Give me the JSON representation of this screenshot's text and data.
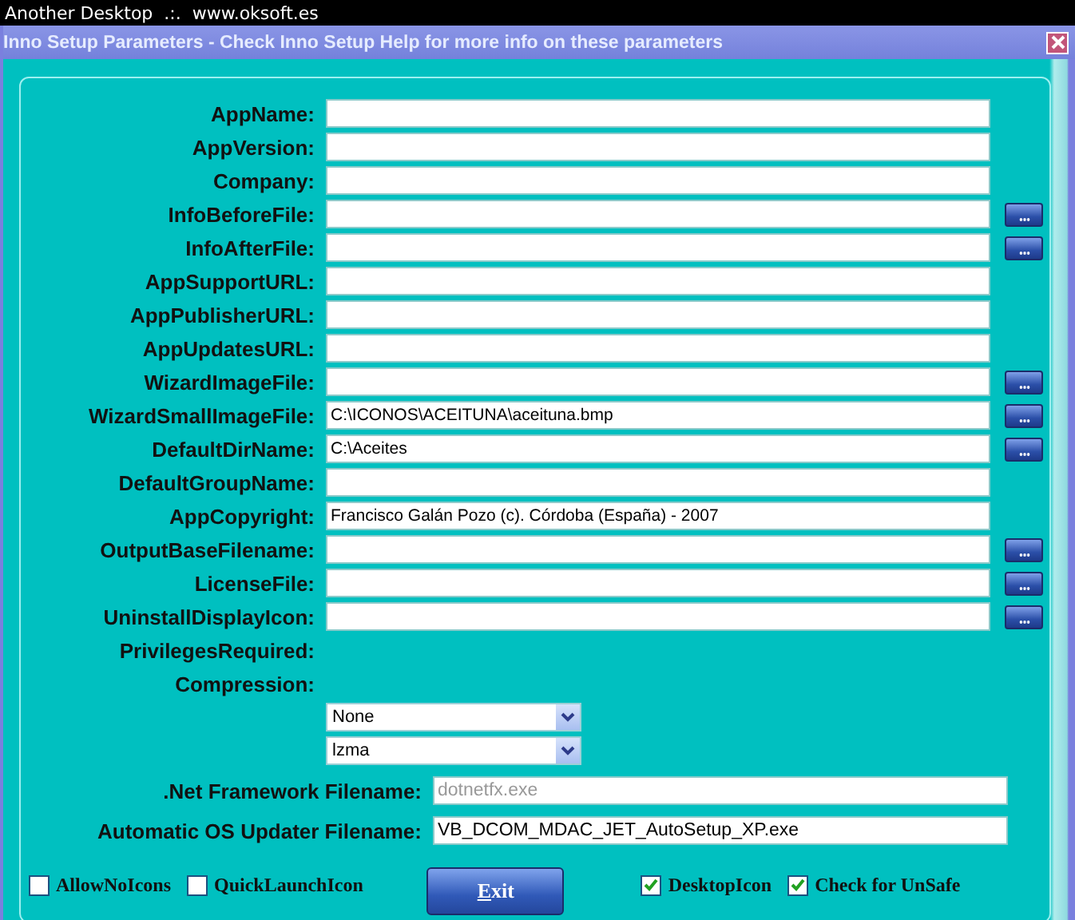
{
  "desktop_bar": {
    "title": "Another Desktop  .:.  www.oksoft.es"
  },
  "window": {
    "title": "Inno Setup Parameters - Check Inno Setup Help for more info on these parameters"
  },
  "fields": [
    {
      "label": "AppName:",
      "kind": "text",
      "browse": false
    },
    {
      "label": "AppVersion:",
      "kind": "text",
      "browse": false
    },
    {
      "label": "Company:",
      "kind": "text",
      "browse": false
    },
    {
      "label": "InfoBeforeFile:",
      "kind": "text",
      "browse": true
    },
    {
      "label": "InfoAfterFile:",
      "kind": "text",
      "browse": true
    },
    {
      "label": "AppSupportURL:",
      "kind": "text",
      "browse": false
    },
    {
      "label": "AppPublisherURL:",
      "kind": "text",
      "browse": false
    },
    {
      "label": "AppUpdatesURL:",
      "kind": "text",
      "browse": false
    },
    {
      "label": "WizardImageFile:",
      "kind": "text",
      "browse": true
    },
    {
      "label": "WizardSmallImageFile:",
      "kind": "text",
      "value": "C:\\ICONOS\\ACEITUNA\\aceituna.bmp",
      "browse": true
    },
    {
      "label": "DefaultDirName:",
      "kind": "text",
      "value": "C:\\Aceites",
      "browse": true
    },
    {
      "label": "DefaultGroupName:",
      "kind": "text",
      "browse": false
    },
    {
      "label": "AppCopyright:",
      "kind": "text",
      "value": "Francisco Galán Pozo (c). Córdoba (España) - 2007",
      "browse": false
    },
    {
      "label": "OutputBaseFilename:",
      "kind": "text",
      "browse": true
    },
    {
      "label": "LicenseFile:",
      "kind": "text",
      "browse": true
    },
    {
      "label": "UninstallDisplayIcon:",
      "kind": "text",
      "browse": true
    },
    {
      "label": "PrivilegesRequired:",
      "kind": "label"
    },
    {
      "label": "Compression:",
      "kind": "label"
    },
    {
      "kind": "dropdown",
      "value": "None"
    },
    {
      "kind": "dropdown",
      "value": "lzma"
    },
    {
      "label": ".Net Framework Filename:",
      "kind": "wide",
      "placeholder": "dotnetfx.exe"
    },
    {
      "label": "Automatic OS Updater Filename:",
      "kind": "wide",
      "value": "VB_DCOM_MDAC_JET_AutoSetup_XP.exe"
    }
  ],
  "checkboxes_left": [
    {
      "label": "AllowNoIcons",
      "checked": false
    },
    {
      "label": "QuickLaunchIcon",
      "checked": false
    }
  ],
  "exit_button": {
    "label": "Exit"
  },
  "checkboxes_right": [
    {
      "label": "DesktopIcon",
      "checked": true
    },
    {
      "label": "Check for UnSafe",
      "checked": true
    }
  ]
}
